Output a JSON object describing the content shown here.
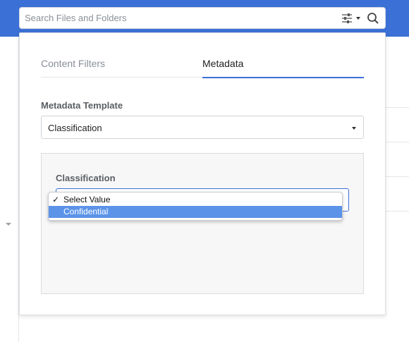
{
  "search": {
    "placeholder": "Search Files and Folders"
  },
  "icons": {
    "filter": "sliders-icon",
    "dropdown": "caret-down-icon",
    "search": "magnifier-icon",
    "selected": "check-icon"
  },
  "colors": {
    "header": "#3b70d6",
    "accent": "#3b70d6",
    "highlight": "#5a93e8"
  },
  "panel": {
    "tabs": [
      {
        "label": "Content Filters",
        "active": false
      },
      {
        "label": "Metadata",
        "active": true
      }
    ],
    "template_label": "Metadata Template",
    "template_value": "Classification",
    "field": {
      "label": "Classification",
      "options": [
        {
          "label": "Select Value",
          "checked": true,
          "highlighted": false,
          "check_mark": "✓"
        },
        {
          "label": "Confidential",
          "checked": false,
          "highlighted": true
        }
      ]
    }
  }
}
